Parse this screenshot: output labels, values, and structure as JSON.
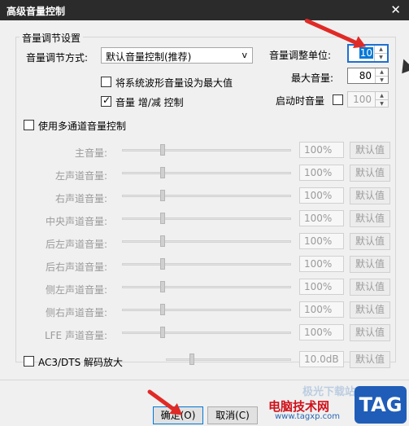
{
  "window": {
    "title": "高级音量控制",
    "close_glyph": "✕"
  },
  "group": {
    "legend": "音量调节设置"
  },
  "adjust_mode": {
    "label": "音量调节方式:",
    "selected": "默认音量控制(推荐)",
    "dropdown_glyph": "v"
  },
  "checks": {
    "waveform": {
      "label": "将系统波形音量设为最大值",
      "checked": false
    },
    "volume_keys": {
      "label": "音量 增/减 控制",
      "checked": true
    },
    "startup_volume": {
      "label": "启动时音量",
      "checked": false
    },
    "multichannel": {
      "label": "使用多通道音量控制",
      "checked": false
    },
    "ac3_dts": {
      "label": "AC3/DTS 解码放大",
      "checked": false
    }
  },
  "adjust_unit": {
    "label": "音量调整单位:",
    "value": "10"
  },
  "max_volume": {
    "label": "最大音量:",
    "value": "80"
  },
  "startup_value": "100",
  "channels": [
    {
      "label": "主音量:",
      "value": "100%",
      "level": 0.22
    },
    {
      "label": "左声道音量:",
      "value": "100%",
      "level": 0.22
    },
    {
      "label": "右声道音量:",
      "value": "100%",
      "level": 0.22
    },
    {
      "label": "中央声道音量:",
      "value": "100%",
      "level": 0.22
    },
    {
      "label": "后左声道音量:",
      "value": "100%",
      "level": 0.22
    },
    {
      "label": "后右声道音量:",
      "value": "100%",
      "level": 0.22
    },
    {
      "label": "侧左声道音量:",
      "value": "100%",
      "level": 0.22
    },
    {
      "label": "侧右声道音量:",
      "value": "100%",
      "level": 0.22
    },
    {
      "label": "LFE 声道音量:",
      "value": "100%",
      "level": 0.22
    }
  ],
  "default_label": "默认值",
  "ac3": {
    "value": "10.0dB",
    "level": 0.18
  },
  "buttons": {
    "ok": "确定(O)",
    "cancel": "取消(C)"
  },
  "watermark": {
    "line1": "极光下载站",
    "line2": "电脑技术网",
    "line3": "www.tagxp.com",
    "badge": "TAG"
  }
}
